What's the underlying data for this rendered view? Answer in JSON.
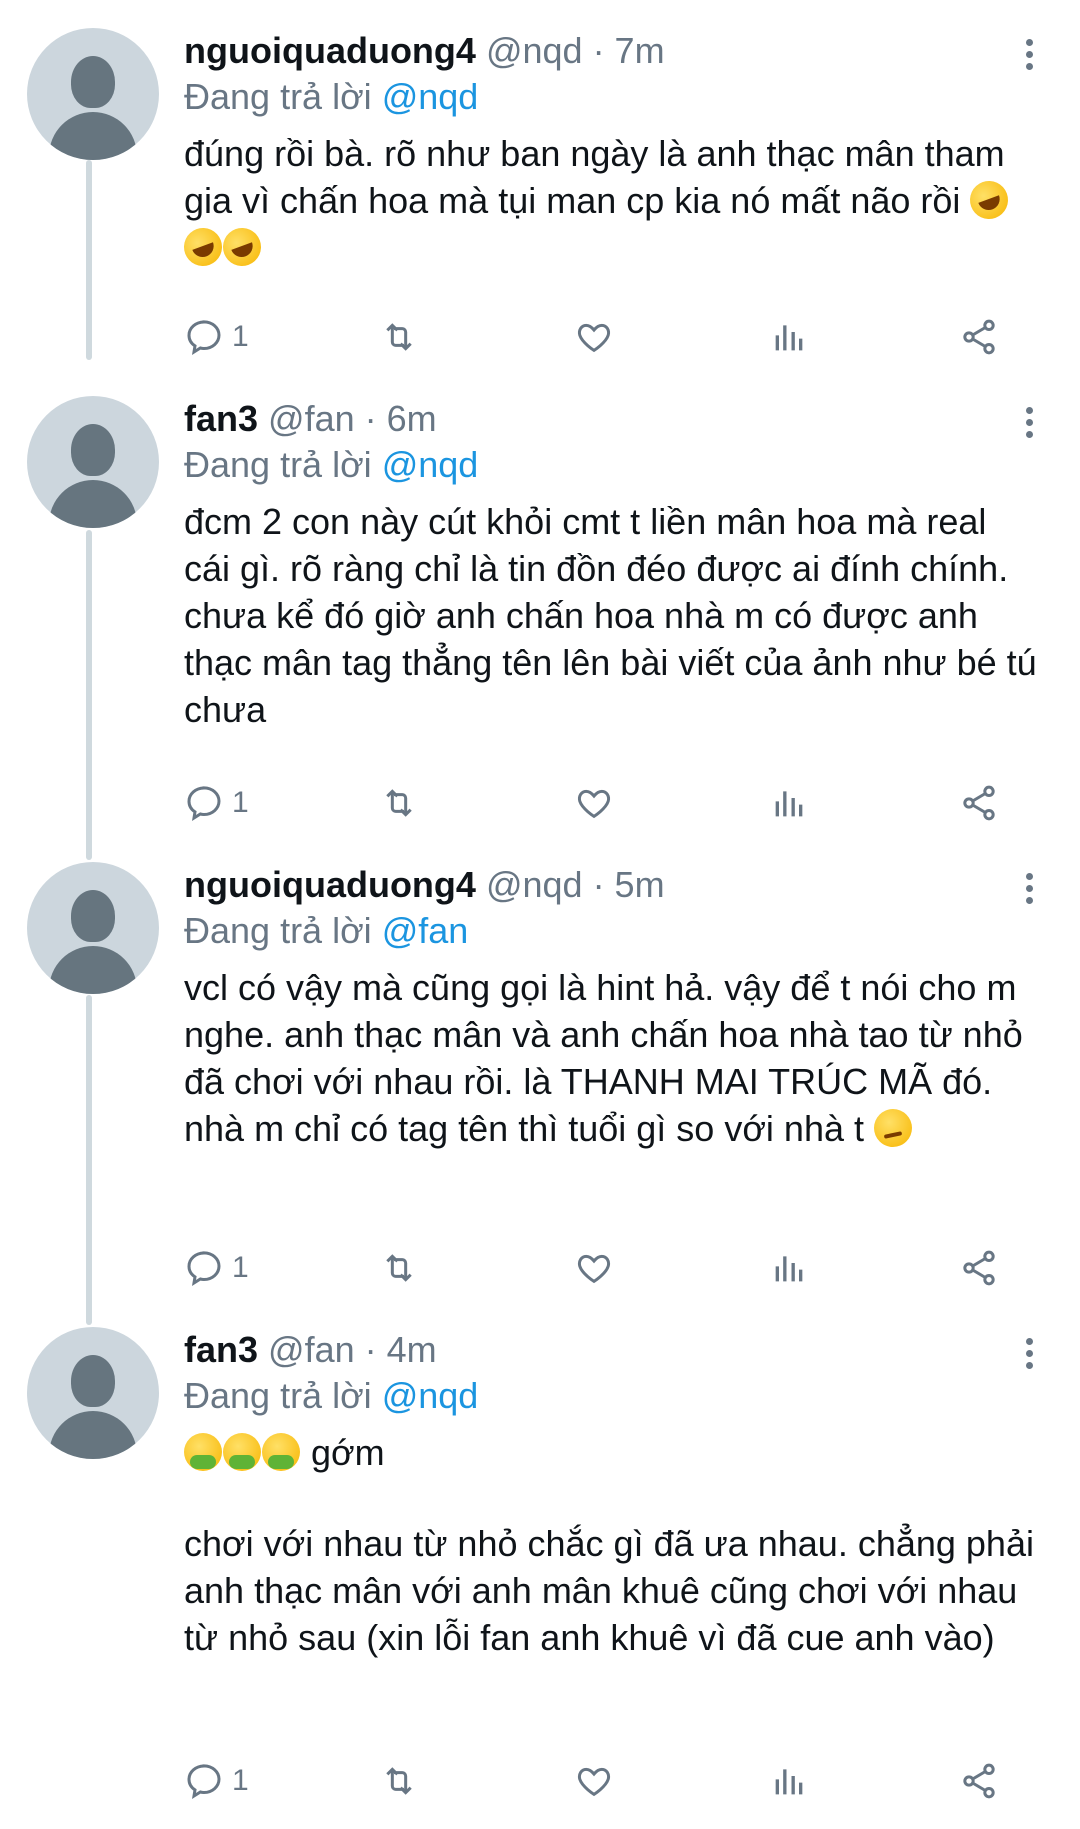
{
  "tweets": [
    {
      "name": "nguoiquaduong4",
      "meta": "@nqd · 7m",
      "replying_prefix": "Đang trả lời",
      "replying_to": "@nqd",
      "text": "đúng rồi bà. rõ như ban ngày là anh thạc mân tham gia vì chấn hoa mà tụi man cp kia nó mất não rồi",
      "emoji": [
        "rolling-on-floor-laughing-emoji",
        "rolling-on-floor-laughing-emoji",
        "rolling-on-floor-laughing-emoji"
      ],
      "reply_count": "1"
    },
    {
      "name": "fan3",
      "meta": "@fan · 6m",
      "replying_prefix": "Đang trả lời",
      "replying_to": "@nqd",
      "text": "đcm 2 con này cút khỏi cmt t liền mân hoa mà real cái gì. rõ ràng chỉ là tin đồn đéo được ai đính chính. chưa kể đó giờ anh chấn hoa nhà m có được anh thạc mân tag thẳng tên lên bài viết của ảnh như bé tú chưa",
      "reply_count": "1"
    },
    {
      "name": "nguoiquaduong4",
      "meta": "@nqd · 5m",
      "replying_prefix": "Đang trả lời",
      "replying_to": "@fan",
      "text": "vcl có vậy mà cũng gọi là hint hả. vậy để t nói cho m nghe. anh thạc mân và anh chấn hoa nhà tao từ nhỏ đã chơi với nhau rồi. là THANH MAI TRÚC MÃ đó. nhà m chỉ có tag tên thì tuổi gì so với nhà t",
      "emoji": [
        "smirking-face-emoji"
      ],
      "reply_count": "1"
    },
    {
      "name": "fan3",
      "meta": "@fan · 4m",
      "replying_prefix": "Đang trả lời",
      "replying_to": "@nqd",
      "text_lead": "gớm",
      "emoji": [
        "vomiting-face-emoji",
        "vomiting-face-emoji",
        "vomiting-face-emoji"
      ],
      "text": "chơi với nhau từ nhỏ chắc gì đã ưa nhau. chẳng phải anh thạc mân với anh mân khuê cũng chơi với nhau từ nhỏ sau (xin lỗi fan anh khuê vì đã cue anh vào)",
      "reply_count": "1"
    }
  ],
  "colors": {
    "accent": "#1b95e0",
    "muted": "#687684",
    "text": "#0f1419",
    "avatar_bg": "#ccd6dd",
    "avatar_fg": "#66757f",
    "thread_line": "#cfd9de"
  },
  "icons": [
    "reply-icon",
    "retweet-icon",
    "like-icon",
    "analytics-icon",
    "share-icon",
    "more-options-icon"
  ]
}
